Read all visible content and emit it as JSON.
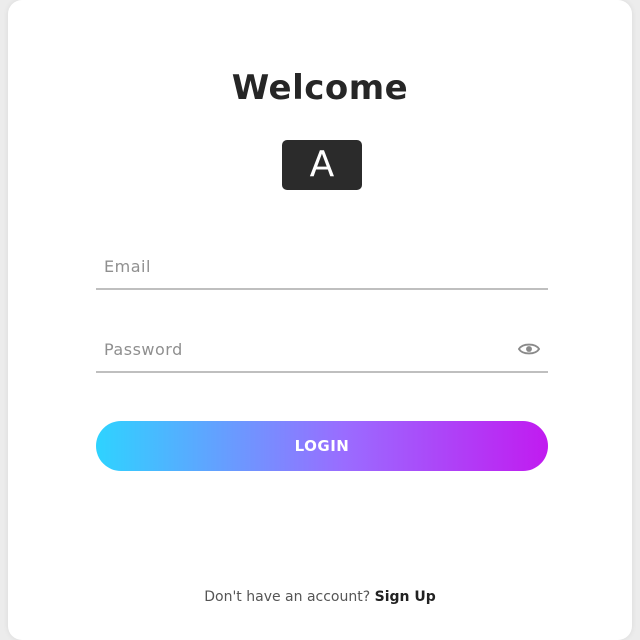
{
  "header": {
    "title": "Welcome",
    "logo_letter": "A"
  },
  "form": {
    "email_placeholder": "Email",
    "email_value": "",
    "password_placeholder": "Password",
    "password_value": "",
    "password_toggle_icon": "eye-icon",
    "login_label": "LOGIN"
  },
  "footer": {
    "prompt": "Don't have an account?",
    "signup_label": "Sign Up"
  },
  "colors": {
    "gradient_start": "#2ed3ff",
    "gradient_end": "#c11bf0",
    "logo_bg": "#2b2b2b"
  }
}
